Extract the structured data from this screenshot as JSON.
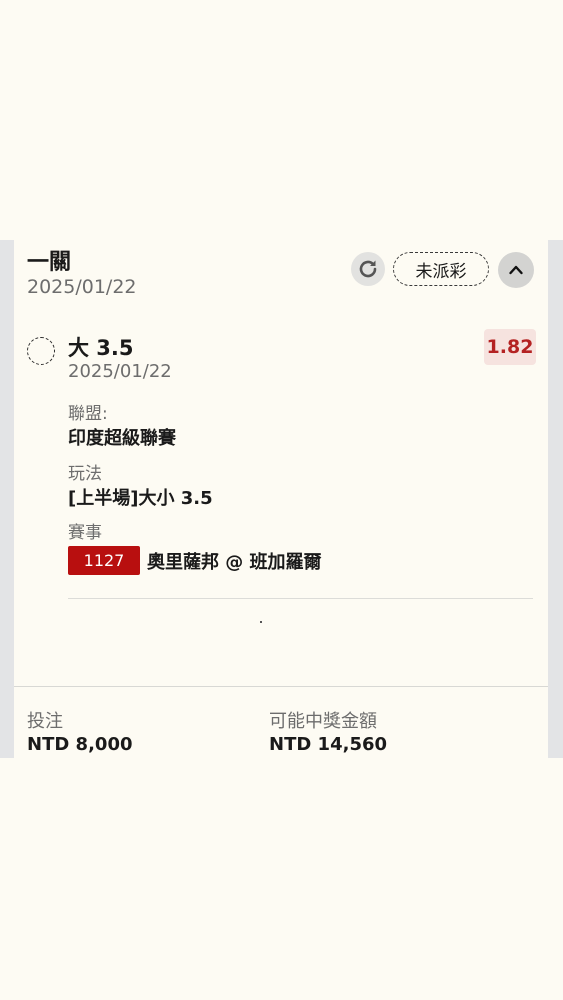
{
  "bet": {
    "type_title": "一關",
    "date": "2025/01/22",
    "status": "未派彩",
    "icons": {
      "refresh": "refresh-icon",
      "collapse": "chevron-up-icon",
      "selection": "pending-circle-icon"
    }
  },
  "selection": {
    "name": "大 3.5",
    "date": "2025/01/22",
    "odds": "1.82",
    "league_label": "聯盟:",
    "league": "印度超級聯賽",
    "market_label": "玩法",
    "market": "[上半場]大小 3.5",
    "event_label": "賽事",
    "event_code": "1127",
    "event_name": "奧里薩邦 @ 班加羅爾"
  },
  "summary": {
    "stake_label": "投注",
    "stake": "NTD 8,000",
    "payout_label": "可能中獎金額",
    "payout": "NTD 14,560"
  },
  "colors": {
    "page_bg": "#fdfbf3",
    "odds_text": "#b42222",
    "odds_bg": "#f6e3df",
    "event_badge": "#b80f0f",
    "side_frame": "#e3e4e6"
  }
}
